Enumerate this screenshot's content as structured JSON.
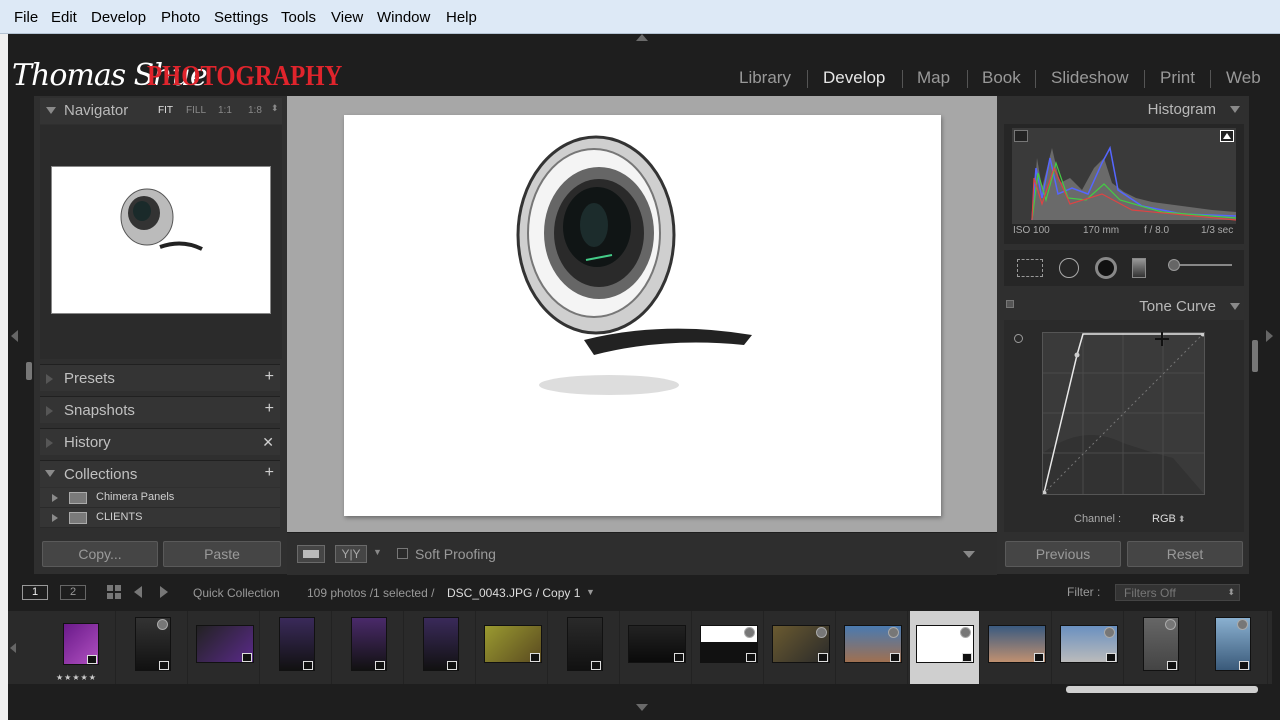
{
  "menu": [
    "File",
    "Edit",
    "Develop",
    "Photo",
    "Settings",
    "Tools",
    "View",
    "Window",
    "Help"
  ],
  "brand": {
    "script_text": "Thomas Shue",
    "word": "PHOTOGRAPHY",
    "accent": "#e0242c"
  },
  "modules": [
    "Library",
    "Develop",
    "Map",
    "Book",
    "Slideshow",
    "Print",
    "Web"
  ],
  "active_module": "Develop",
  "navigator": {
    "title": "Navigator",
    "zoom_options": [
      "FIT",
      "FILL",
      "1:1",
      "1:8"
    ],
    "selected_zoom": "FIT"
  },
  "left_sections": {
    "presets": "Presets",
    "snapshots": "Snapshots",
    "history": "History",
    "collections": "Collections"
  },
  "collections": [
    "Chimera Panels",
    "CLIENTS"
  ],
  "left_buttons": {
    "copy": "Copy...",
    "paste": "Paste"
  },
  "histogram": {
    "title": "Histogram",
    "iso": "ISO 100",
    "focal": "170 mm",
    "aperture": "f / 8.0",
    "shutter": "1/3 sec"
  },
  "tone_curve": {
    "title": "Tone Curve",
    "channel_label": "Channel :",
    "channel_value": "RGB"
  },
  "right_buttons": {
    "previous": "Previous",
    "reset": "Reset"
  },
  "toolbar": {
    "soft_proofing": "Soft Proofing"
  },
  "filmstrip_header": {
    "page1": "1",
    "page2": "2",
    "source": "Quick Collection",
    "count": "109 photos /1 selected /",
    "filename": "DSC_0043.JPG / Copy 1",
    "filter_label": "Filter :",
    "filter_value": "Filters Off"
  },
  "filmstrip": {
    "rating": "★★★★★",
    "selected_index": 12
  }
}
